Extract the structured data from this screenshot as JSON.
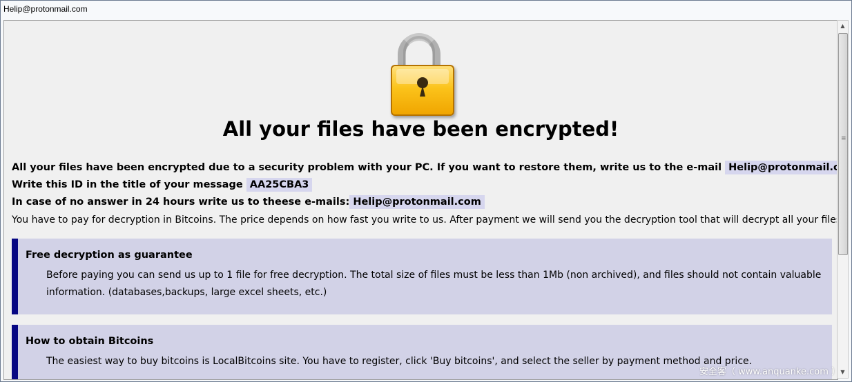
{
  "window": {
    "title": "Helip@protonmail.com"
  },
  "headline": "All your files have been encrypted!",
  "lines": {
    "l1_text": "All your files have been encrypted due to a security problem with your PC. If you want to restore them, write us to the e-mail",
    "l1_email": "Helip@protonmail.com",
    "l2_text": "Write this ID in the title of your message",
    "l2_id": "AA25CBA3",
    "l3_text": "In case of no answer in 24 hours write us to theese e-mails:",
    "l3_email": "Helip@protonmail.com",
    "l4_text": "You have to pay for decryption in Bitcoins. The price depends on how fast you write to us. After payment we will send you the decryption tool that will decrypt all your files."
  },
  "panels": [
    {
      "title": "Free decryption as guarantee",
      "text": "Before paying you can send us up to 1 file for free decryption. The total size of files must be less than 1Mb (non archived), and files should not contain valuable information. (databases,backups, large excel sheets, etc.)"
    },
    {
      "title": "How to obtain Bitcoins",
      "text": "The easiest way to buy bitcoins is LocalBitcoins site. You have to register, click 'Buy bitcoins', and select the seller by payment method and price."
    }
  ],
  "watermark": "安全客（ www.anquanke.com ）",
  "icons": {
    "lock": "padlock-icon"
  },
  "colors": {
    "panel_bg": "#d2d2e7",
    "panel_accent": "#070783",
    "highlight_bg": "#d6d6ee"
  }
}
